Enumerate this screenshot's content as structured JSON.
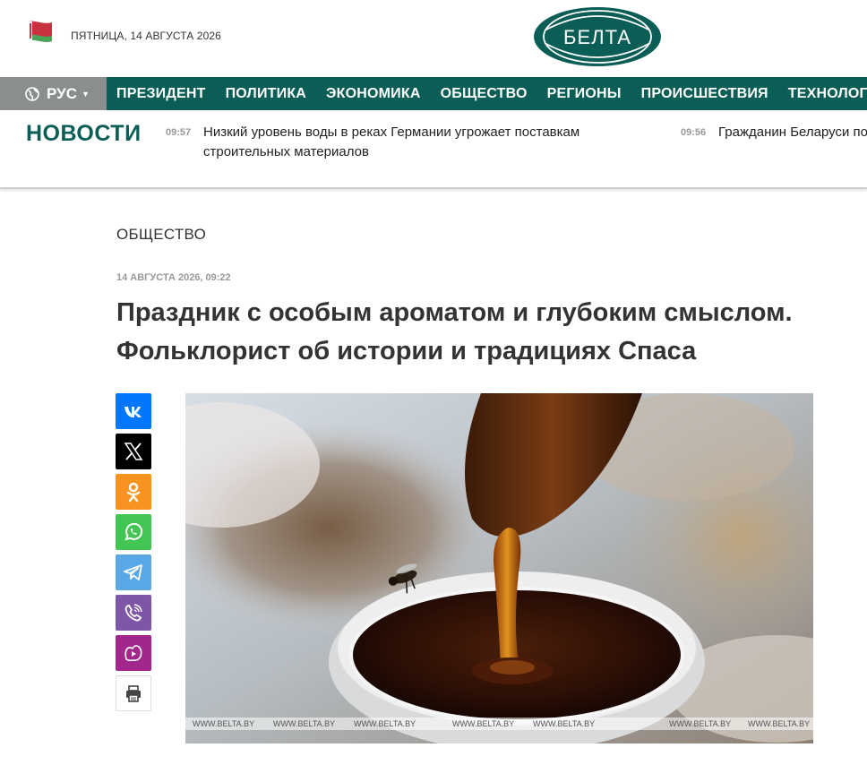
{
  "header": {
    "date": "ПЯТНИЦА, 14 АВГУСТА 2026",
    "logo_text": "БЕЛТА"
  },
  "nav": {
    "language": "РУС",
    "items": [
      "ПРЕЗИДЕНТ",
      "ПОЛИТИКА",
      "ЭКОНОМИКА",
      "ОБЩЕСТВО",
      "РЕГИОНЫ",
      "ПРОИСШЕСТВИЯ",
      "ТЕХНОЛОГИИ"
    ]
  },
  "ticker": {
    "title": "НОВОСТИ",
    "items": [
      {
        "time": "09:57",
        "headline": "Низкий уровень воды в реках Германии угрожает поставкам строительных материалов"
      },
      {
        "time": "09:56",
        "headline": "Гражданин Беларуси по"
      }
    ]
  },
  "article": {
    "section": "ОБЩЕСТВО",
    "date": "14 АВГУСТА 2026, 09:22",
    "title": "Праздник с особым ароматом и глубоким смыслом. Фольклорист об истории и традициях Спаса",
    "photo_watermark": "WWW.BELTA.BY"
  },
  "share": [
    "vk-icon",
    "x-icon",
    "odnoklassniki-icon",
    "whatsapp-icon",
    "telegram-icon",
    "viber-icon",
    "alice-icon",
    "print-icon"
  ],
  "colors": {
    "brand_green": "#0a5e55",
    "lang_gray": "#8a8e8f"
  }
}
